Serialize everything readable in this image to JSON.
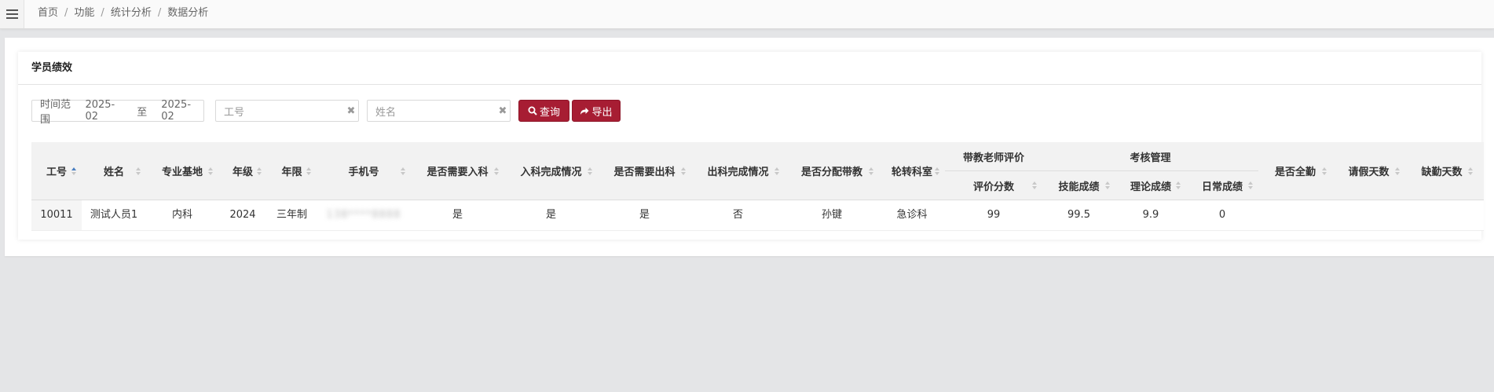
{
  "topbar": {
    "breadcrumb": [
      "首页",
      "功能",
      "统计分析",
      "数据分析"
    ],
    "separator": "/"
  },
  "card": {
    "title": "学员绩效"
  },
  "filters": {
    "date_range": {
      "label": "时间范围",
      "start": "2025-02",
      "to": "至",
      "end": "2025-02"
    },
    "employee_id": {
      "placeholder": "工号",
      "clear": "✖"
    },
    "name": {
      "placeholder": "姓名",
      "clear": "✖"
    },
    "query_button": "查询",
    "export_button": "导出"
  },
  "table": {
    "headers": {
      "employee_id": "工号",
      "name": "姓名",
      "base": "专业基地",
      "grade": "年级",
      "term": "年限",
      "phone": "手机号",
      "need_entry": "是否需要入科",
      "entry_status": "入科完成情况",
      "need_exit": "是否需要出科",
      "exit_status": "出科完成情况",
      "assigned_teacher": "是否分配带教",
      "rotation_dept": "轮转科室",
      "teacher_eval_group": "带教老师评价",
      "eval_score": "评价分数",
      "exam_group": "考核管理",
      "skill_score": "技能成绩",
      "theory_score": "理论成绩",
      "daily_score": "日常成绩",
      "full_attendance": "是否全勤",
      "leave_days": "请假天数",
      "absent_days": "缺勤天数"
    },
    "rows": [
      {
        "employee_id": "10011",
        "name": "测试人员1",
        "base": "内科",
        "grade": "2024",
        "term": "三年制",
        "phone": "138****8888",
        "need_entry": "是",
        "entry_status": "是",
        "need_exit": "是",
        "exit_status": "否",
        "assigned_teacher": "孙键",
        "rotation_dept": "急诊科",
        "eval_score": "99",
        "skill_score": "99.5",
        "theory_score": "9.9",
        "daily_score": "0",
        "full_attendance": "",
        "leave_days": "",
        "absent_days": ""
      }
    ]
  },
  "colors": {
    "primary_button": "#a71d33",
    "header_bg": "#f2f2f2",
    "page_bg": "#e4e5e7"
  }
}
